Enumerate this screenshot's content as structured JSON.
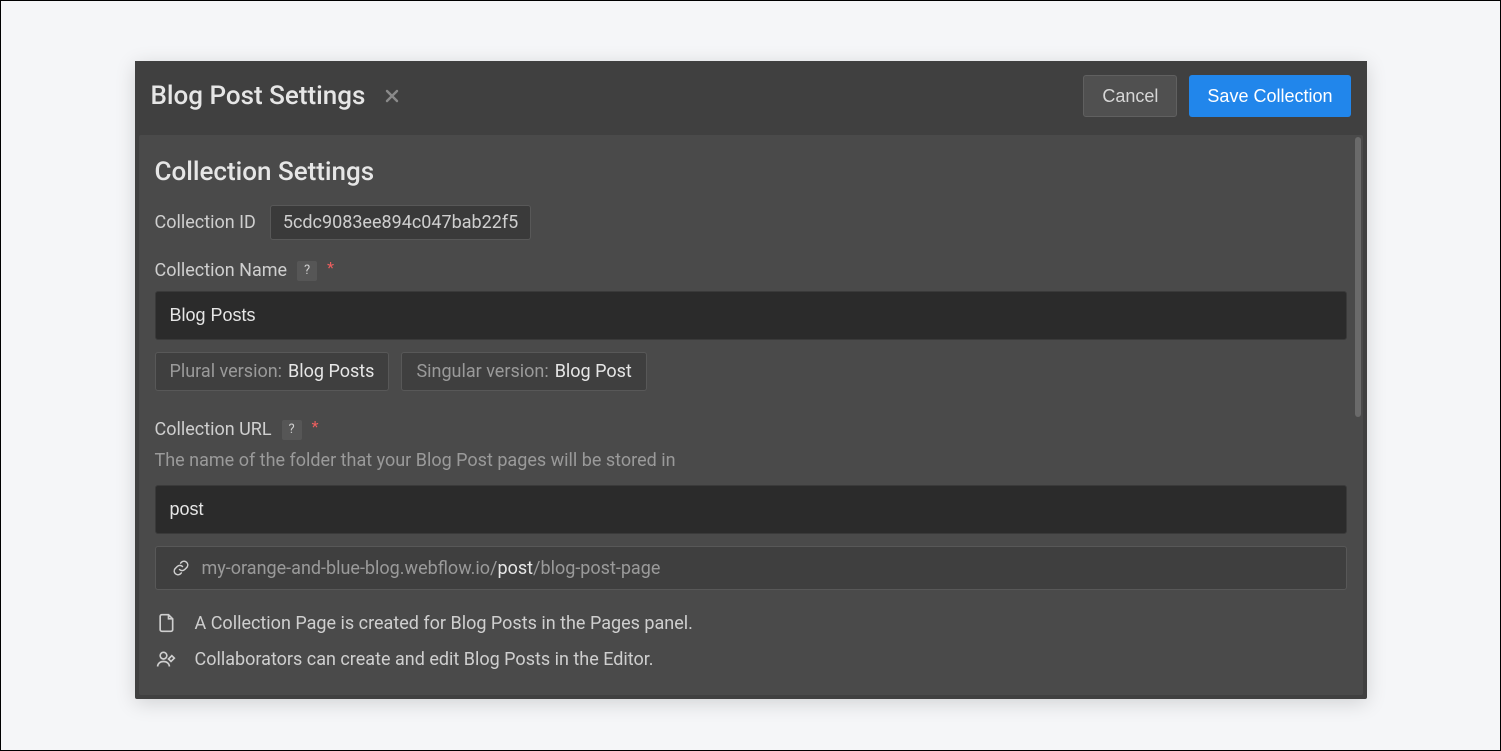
{
  "dialog": {
    "title": "Blog Post Settings",
    "cancel_label": "Cancel",
    "save_label": "Save Collection"
  },
  "section": {
    "title": "Collection Settings",
    "collection_id_label": "Collection ID",
    "collection_id_value": "5cdc9083ee894c047bab22f5",
    "name_label": "Collection Name",
    "name_value": "Blog Posts",
    "plural_key": "Plural version:",
    "plural_value": "Blog Posts",
    "singular_key": "Singular version:",
    "singular_value": "Blog Post",
    "url_label": "Collection URL",
    "url_helper": "The name of the folder that your Blog Post pages will be stored in",
    "url_value": "post",
    "url_preview_prefix": "my-orange-and-blue-blog.webflow.io/",
    "url_preview_slug": "post",
    "url_preview_suffix": "/blog-post-page",
    "info_page": "A Collection Page is created for Blog Posts in the Pages panel.",
    "info_collab": "Collaborators can create and edit Blog Posts in the Editor.",
    "help_glyph": "?",
    "required_glyph": "*"
  }
}
